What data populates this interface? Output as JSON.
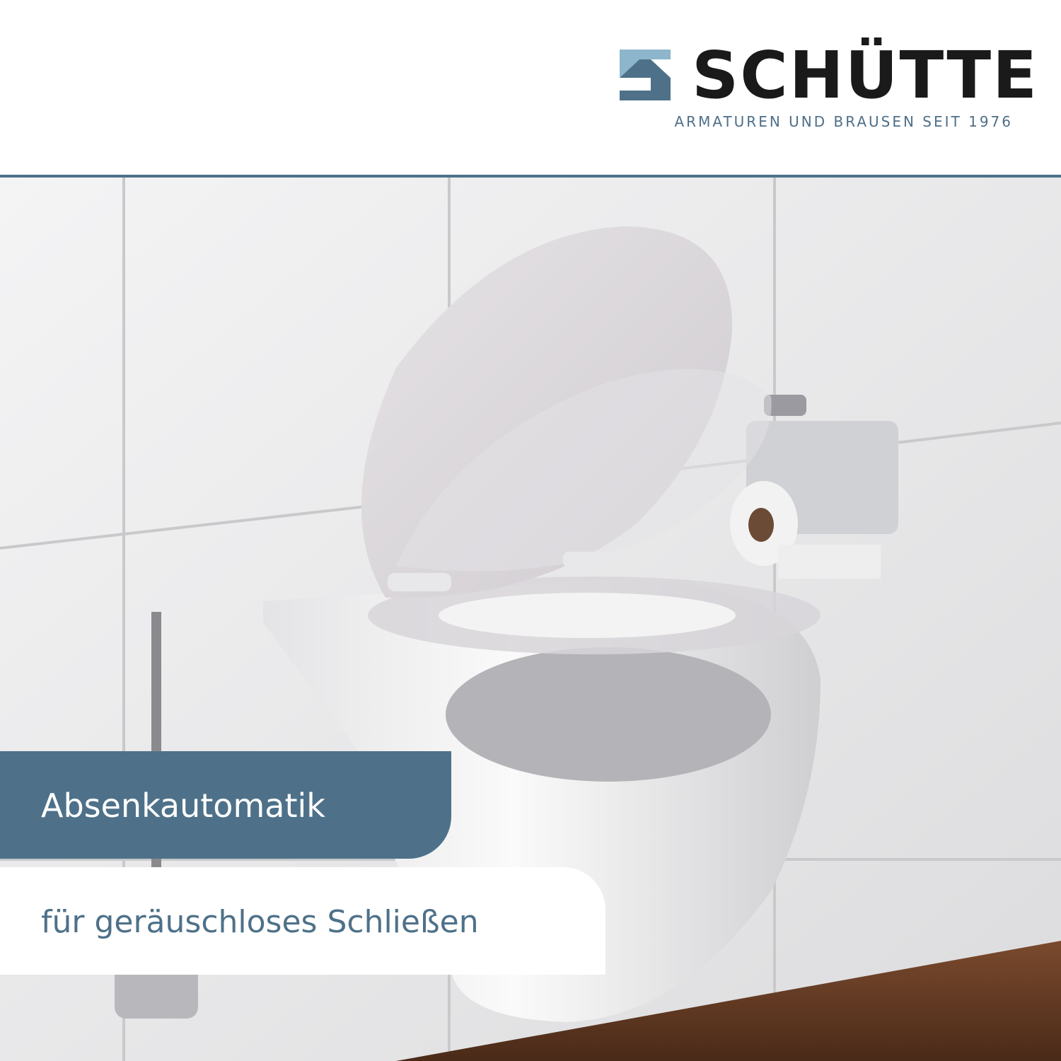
{
  "brand": {
    "name": "SCHÜTTE",
    "tagline": "ARMATUREN UND BRAUSEN SEIT 1976",
    "mark_colors": [
      "#8db6cc",
      "#4e7189"
    ]
  },
  "feature": {
    "title": "Absenkautomatik",
    "subtitle": "für geräuschloses Schließen"
  },
  "colors": {
    "accent": "#4e7189",
    "text_dark": "#1a1a1a",
    "background": "#ffffff"
  }
}
